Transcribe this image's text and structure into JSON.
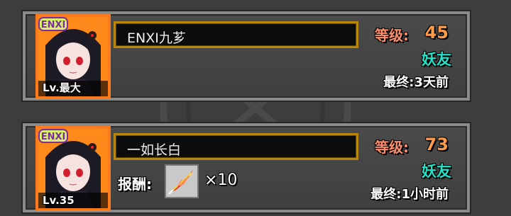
{
  "friends": [
    {
      "badge": "ENXI",
      "level_tag": "Lv.最大",
      "name": "ENXI九芗",
      "level_label": "等级:",
      "level_value": "45",
      "relation": "妖友",
      "last_seen": "最终:3天前"
    },
    {
      "badge": "ENXI",
      "level_tag": "Lv.35",
      "name": "一如长白",
      "level_label": "等级:",
      "level_value": "73",
      "relation": "妖友",
      "last_seen": "最终:1小时前",
      "reward_label": "报酬:",
      "reward_count": "×10",
      "reward_icon": "red-feather-icon"
    }
  ],
  "colors": {
    "badge_fill": "#d9f26a",
    "portrait_border": "#ff7a1a",
    "level_color": "#ff9a4a",
    "relation_color": "#22e3c8",
    "namebox_border": "#b8860b"
  }
}
